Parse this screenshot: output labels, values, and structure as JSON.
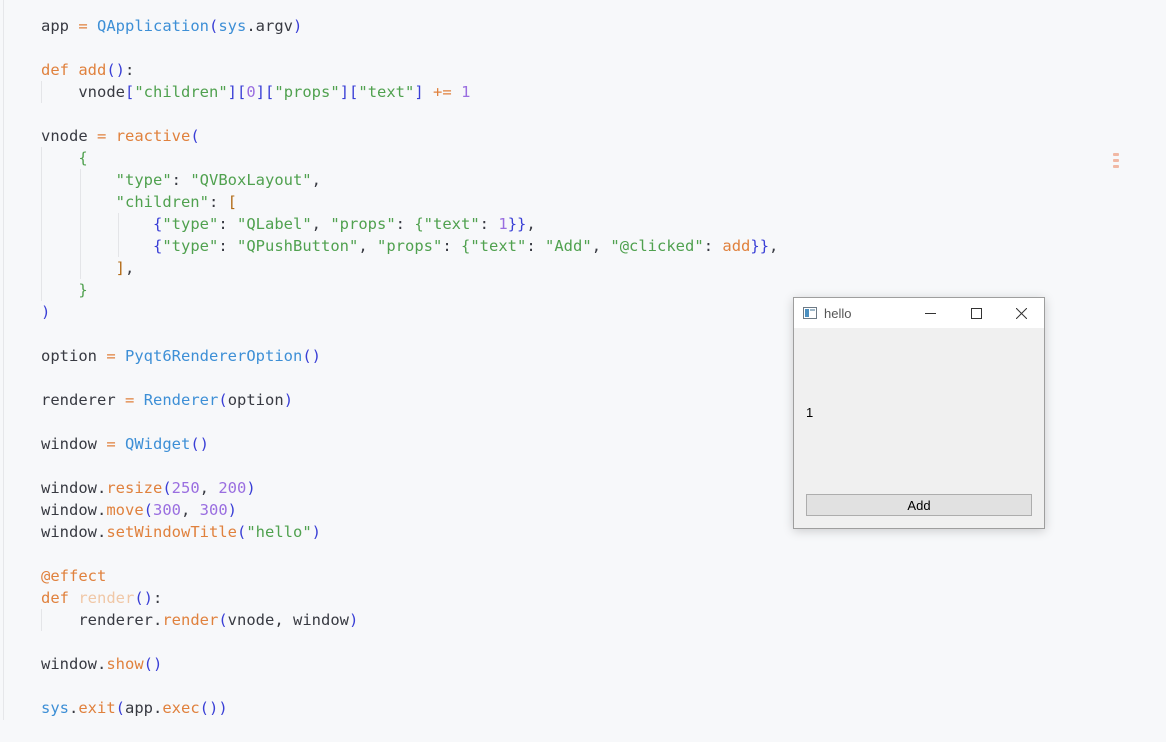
{
  "editor": {
    "lines": [
      [
        [
          "app ",
          "p"
        ],
        [
          "=",
          "k"
        ],
        [
          " ",
          "p"
        ],
        [
          "QApplication",
          "c"
        ],
        [
          "(",
          "b1"
        ],
        [
          "sys",
          "c"
        ],
        [
          ".argv",
          "p"
        ],
        [
          ")",
          "b1"
        ]
      ],
      [],
      [
        [
          "def",
          "k"
        ],
        [
          " ",
          "p"
        ],
        [
          "add",
          "k"
        ],
        [
          "()",
          "b1"
        ],
        [
          ":",
          "p"
        ]
      ],
      [
        [
          "    vnode",
          "p"
        ],
        [
          "[",
          "b1"
        ],
        [
          "\"children\"",
          "s"
        ],
        [
          "][",
          "b1"
        ],
        [
          "0",
          "n"
        ],
        [
          "][",
          "b1"
        ],
        [
          "\"props\"",
          "s"
        ],
        [
          "][",
          "b1"
        ],
        [
          "\"text\"",
          "s"
        ],
        [
          "]",
          "b1"
        ],
        [
          " ",
          "p"
        ],
        [
          "+=",
          "k"
        ],
        [
          " ",
          "p"
        ],
        [
          "1",
          "n"
        ]
      ],
      [],
      [
        [
          "vnode ",
          "p"
        ],
        [
          "=",
          "k"
        ],
        [
          " ",
          "p"
        ],
        [
          "reactive",
          "k"
        ],
        [
          "(",
          "b1"
        ]
      ],
      [
        [
          "    ",
          "p"
        ],
        [
          "{",
          "b2"
        ]
      ],
      [
        [
          "        ",
          "p"
        ],
        [
          "\"type\"",
          "s"
        ],
        [
          ": ",
          "p"
        ],
        [
          "\"QVBoxLayout\"",
          "s"
        ],
        [
          ",",
          "p"
        ]
      ],
      [
        [
          "        ",
          "p"
        ],
        [
          "\"children\"",
          "s"
        ],
        [
          ": ",
          "p"
        ],
        [
          "[",
          "b3"
        ]
      ],
      [
        [
          "            ",
          "p"
        ],
        [
          "{",
          "b1"
        ],
        [
          "\"type\"",
          "s"
        ],
        [
          ": ",
          "p"
        ],
        [
          "\"QLabel\"",
          "s"
        ],
        [
          ", ",
          "p"
        ],
        [
          "\"props\"",
          "s"
        ],
        [
          ": ",
          "p"
        ],
        [
          "{",
          "b2"
        ],
        [
          "\"text\"",
          "s"
        ],
        [
          ": ",
          "p"
        ],
        [
          "1",
          "n"
        ],
        [
          "}}",
          "b1"
        ],
        [
          ",",
          "p"
        ]
      ],
      [
        [
          "            ",
          "p"
        ],
        [
          "{",
          "b1"
        ],
        [
          "\"type\"",
          "s"
        ],
        [
          ": ",
          "p"
        ],
        [
          "\"QPushButton\"",
          "s"
        ],
        [
          ", ",
          "p"
        ],
        [
          "\"props\"",
          "s"
        ],
        [
          ": ",
          "p"
        ],
        [
          "{",
          "b2"
        ],
        [
          "\"text\"",
          "s"
        ],
        [
          ": ",
          "p"
        ],
        [
          "\"Add\"",
          "s"
        ],
        [
          ", ",
          "p"
        ],
        [
          "\"@clicked\"",
          "s"
        ],
        [
          ": ",
          "p"
        ],
        [
          "add",
          "k"
        ],
        [
          "}}",
          "b1"
        ],
        [
          ",",
          "p"
        ]
      ],
      [
        [
          "        ",
          "p"
        ],
        [
          "]",
          "b3"
        ],
        [
          ",",
          "p"
        ]
      ],
      [
        [
          "    ",
          "p"
        ],
        [
          "}",
          "b2"
        ]
      ],
      [
        [
          ")",
          "b1"
        ]
      ],
      [],
      [
        [
          "option ",
          "p"
        ],
        [
          "=",
          "k"
        ],
        [
          " ",
          "p"
        ],
        [
          "Pyqt6RendererOption",
          "c"
        ],
        [
          "()",
          "b1"
        ]
      ],
      [],
      [
        [
          "renderer ",
          "p"
        ],
        [
          "=",
          "k"
        ],
        [
          " ",
          "p"
        ],
        [
          "Renderer",
          "c"
        ],
        [
          "(",
          "b1"
        ],
        [
          "option",
          "p"
        ],
        [
          ")",
          "b1"
        ]
      ],
      [],
      [
        [
          "window ",
          "p"
        ],
        [
          "=",
          "k"
        ],
        [
          " ",
          "p"
        ],
        [
          "QWidget",
          "c"
        ],
        [
          "()",
          "b1"
        ]
      ],
      [],
      [
        [
          "window.",
          "p"
        ],
        [
          "resize",
          "k"
        ],
        [
          "(",
          "b1"
        ],
        [
          "250",
          "n"
        ],
        [
          ", ",
          "p"
        ],
        [
          "200",
          "n"
        ],
        [
          ")",
          "b1"
        ]
      ],
      [
        [
          "window.",
          "p"
        ],
        [
          "move",
          "k"
        ],
        [
          "(",
          "b1"
        ],
        [
          "300",
          "n"
        ],
        [
          ", ",
          "p"
        ],
        [
          "300",
          "n"
        ],
        [
          ")",
          "b1"
        ]
      ],
      [
        [
          "window.",
          "p"
        ],
        [
          "setWindowTitle",
          "k"
        ],
        [
          "(",
          "b1"
        ],
        [
          "\"hello\"",
          "s"
        ],
        [
          ")",
          "b1"
        ]
      ],
      [],
      [
        [
          "@effect",
          "k"
        ]
      ],
      [
        [
          "def",
          "k"
        ],
        [
          " ",
          "p"
        ],
        [
          "render",
          "fn-dim"
        ],
        [
          "()",
          "b1"
        ],
        [
          ":",
          "p"
        ]
      ],
      [
        [
          "    renderer.",
          "p"
        ],
        [
          "render",
          "k"
        ],
        [
          "(",
          "b1"
        ],
        [
          "vnode, window",
          "p"
        ],
        [
          ")",
          "b1"
        ]
      ],
      [],
      [
        [
          "window.",
          "p"
        ],
        [
          "show",
          "k"
        ],
        [
          "()",
          "b1"
        ]
      ],
      [],
      [
        [
          "sys",
          "c"
        ],
        [
          ".",
          "p"
        ],
        [
          "exit",
          "k"
        ],
        [
          "(",
          "b1"
        ],
        [
          "app.",
          "p"
        ],
        [
          "exec",
          "k"
        ],
        [
          "())",
          "b1"
        ]
      ]
    ]
  },
  "qt_window": {
    "title": "hello",
    "label_text": "1",
    "button_text": "Add"
  },
  "icons": {
    "app_icon": "window-icon",
    "minimize": "minimize-icon",
    "maximize": "maximize-icon",
    "close": "close-icon"
  }
}
